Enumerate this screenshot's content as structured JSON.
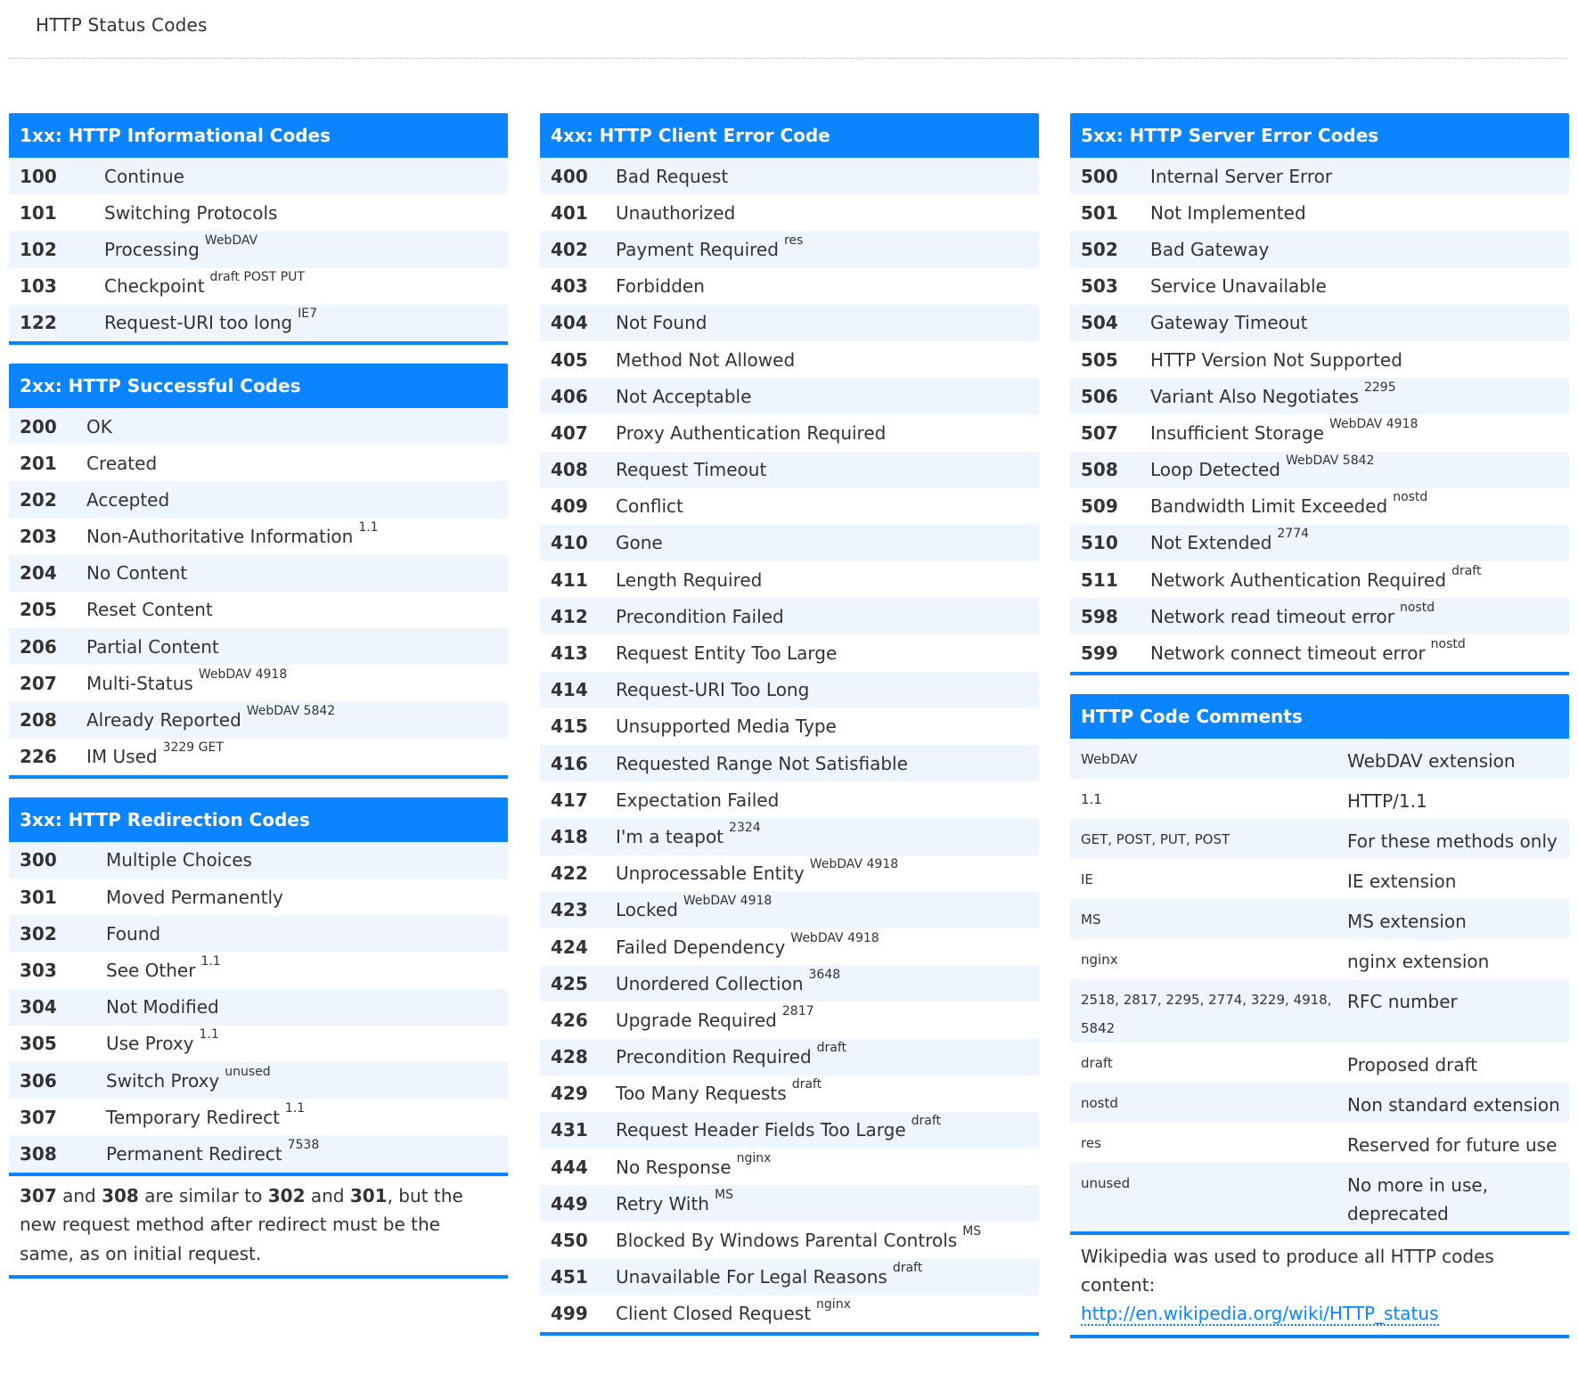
{
  "page_title": "HTTP Status Codes",
  "sections": {
    "s1xx": {
      "title": "1xx: HTTP Informational Codes",
      "rows": [
        {
          "code": "100",
          "label": "Continue",
          "note": ""
        },
        {
          "code": "101",
          "label": "Switching Protocols",
          "note": ""
        },
        {
          "code": "102",
          "label": "Processing",
          "note": "WebDAV"
        },
        {
          "code": "103",
          "label": "Checkpoint",
          "note": "draft POST PUT"
        },
        {
          "code": "122",
          "label": "Request-URI too long",
          "note": "IE7"
        }
      ]
    },
    "s2xx": {
      "title": "2xx: HTTP Successful Codes",
      "rows": [
        {
          "code": "200",
          "label": "OK",
          "note": ""
        },
        {
          "code": "201",
          "label": "Created",
          "note": ""
        },
        {
          "code": "202",
          "label": "Accepted",
          "note": ""
        },
        {
          "code": "203",
          "label": "Non-Authoritative Information",
          "note": "1.1"
        },
        {
          "code": "204",
          "label": "No Content",
          "note": ""
        },
        {
          "code": "205",
          "label": "Reset Content",
          "note": ""
        },
        {
          "code": "206",
          "label": "Partial Content",
          "note": ""
        },
        {
          "code": "207",
          "label": "Multi-Status",
          "note": "WebDAV 4918"
        },
        {
          "code": "208",
          "label": "Already Reported",
          "note": "WebDAV 5842"
        },
        {
          "code": "226",
          "label": "IM Used",
          "note": "3229 GET"
        }
      ]
    },
    "s3xx": {
      "title": "3xx: HTTP Redirection Codes",
      "rows": [
        {
          "code": "300",
          "label": "Multiple Choices",
          "note": ""
        },
        {
          "code": "301",
          "label": "Moved Permanently",
          "note": ""
        },
        {
          "code": "302",
          "label": "Found",
          "note": ""
        },
        {
          "code": "303",
          "label": "See Other",
          "note": "1.1"
        },
        {
          "code": "304",
          "label": "Not Modified",
          "note": ""
        },
        {
          "code": "305",
          "label": "Use Proxy",
          "note": "1.1"
        },
        {
          "code": "306",
          "label": "Switch Proxy",
          "note": "unused"
        },
        {
          "code": "307",
          "label": "Temporary Redirect",
          "note": "1.1"
        },
        {
          "code": "308",
          "label": "Permanent Redirect",
          "note": "7538"
        }
      ],
      "footnote": {
        "code_a": "307",
        "text_and": " and ",
        "code_b": "308",
        "text_mid": " are similar to ",
        "code_c": "302",
        "text_and2": " and ",
        "code_d": "301",
        "text_end": ", but the new request method after redirect must be the same, as on initial request."
      }
    },
    "s4xx": {
      "title": "4xx: HTTP Client Error Code",
      "rows": [
        {
          "code": "400",
          "label": "Bad Request",
          "note": ""
        },
        {
          "code": "401",
          "label": "Unauthorized",
          "note": ""
        },
        {
          "code": "402",
          "label": "Payment Required",
          "note": "res"
        },
        {
          "code": "403",
          "label": "Forbidden",
          "note": ""
        },
        {
          "code": "404",
          "label": "Not Found",
          "note": ""
        },
        {
          "code": "405",
          "label": "Method Not Allowed",
          "note": ""
        },
        {
          "code": "406",
          "label": "Not Acceptable",
          "note": ""
        },
        {
          "code": "407",
          "label": "Proxy Authentication Required",
          "note": ""
        },
        {
          "code": "408",
          "label": "Request Timeout",
          "note": ""
        },
        {
          "code": "409",
          "label": "Conflict",
          "note": ""
        },
        {
          "code": "410",
          "label": "Gone",
          "note": ""
        },
        {
          "code": "411",
          "label": "Length Required",
          "note": ""
        },
        {
          "code": "412",
          "label": "Precondition Failed",
          "note": ""
        },
        {
          "code": "413",
          "label": "Request Entity Too Large",
          "note": ""
        },
        {
          "code": "414",
          "label": "Request-URI Too Long",
          "note": ""
        },
        {
          "code": "415",
          "label": "Unsupported Media Type",
          "note": ""
        },
        {
          "code": "416",
          "label": "Requested Range Not Satisfiable",
          "note": ""
        },
        {
          "code": "417",
          "label": "Expectation Failed",
          "note": ""
        },
        {
          "code": "418",
          "label": "I'm a teapot",
          "note": "2324"
        },
        {
          "code": "422",
          "label": "Unprocessable Entity",
          "note": "WebDAV 4918"
        },
        {
          "code": "423",
          "label": "Locked",
          "note": "WebDAV 4918"
        },
        {
          "code": "424",
          "label": "Failed Dependency",
          "note": "WebDAV 4918"
        },
        {
          "code": "425",
          "label": "Unordered Collection",
          "note": "3648"
        },
        {
          "code": "426",
          "label": "Upgrade Required",
          "note": "2817"
        },
        {
          "code": "428",
          "label": "Precondition Required",
          "note": "draft"
        },
        {
          "code": "429",
          "label": "Too Many Requests",
          "note": "draft"
        },
        {
          "code": "431",
          "label": "Request Header Fields Too Large",
          "note": "draft"
        },
        {
          "code": "444",
          "label": "No Response",
          "note": "nginx"
        },
        {
          "code": "449",
          "label": "Retry With",
          "note": "MS"
        },
        {
          "code": "450",
          "label": "Blocked By Windows Parental Controls",
          "note": "MS"
        },
        {
          "code": "451",
          "label": "Unavailable For Legal Reasons",
          "note": "draft"
        },
        {
          "code": "499",
          "label": "Client Closed Request",
          "note": "nginx"
        }
      ]
    },
    "s5xx": {
      "title": "5xx: HTTP Server Error Codes",
      "rows": [
        {
          "code": "500",
          "label": "Internal Server Error",
          "note": ""
        },
        {
          "code": "501",
          "label": "Not Implemented",
          "note": ""
        },
        {
          "code": "502",
          "label": "Bad Gateway",
          "note": ""
        },
        {
          "code": "503",
          "label": "Service Unavailable",
          "note": ""
        },
        {
          "code": "504",
          "label": "Gateway Timeout",
          "note": ""
        },
        {
          "code": "505",
          "label": "HTTP Version Not Supported",
          "note": ""
        },
        {
          "code": "506",
          "label": "Variant Also Negotiates",
          "note": "2295"
        },
        {
          "code": "507",
          "label": "Insufficient Storage",
          "note": "WebDAV 4918"
        },
        {
          "code": "508",
          "label": "Loop Detected",
          "note": "WebDAV 5842"
        },
        {
          "code": "509",
          "label": "Bandwidth Limit Exceeded",
          "note": "nostd"
        },
        {
          "code": "510",
          "label": "Not Extended",
          "note": "2774"
        },
        {
          "code": "511",
          "label": "Network Authentication Required",
          "note": "draft"
        },
        {
          "code": "598",
          "label": "Network read timeout error",
          "note": "nostd"
        },
        {
          "code": "599",
          "label": "Network connect timeout error",
          "note": "nostd"
        }
      ]
    },
    "comments": {
      "title": "HTTP Code Comments",
      "rows": [
        {
          "key": "WebDAV",
          "value": "WebDAV extension"
        },
        {
          "key": "1.1",
          "value": "HTTP/1.1"
        },
        {
          "key": "GET, POST, PUT, POST",
          "value": "For these methods only"
        },
        {
          "key": "IE",
          "value": "IE extension"
        },
        {
          "key": "MS",
          "value": "MS extension"
        },
        {
          "key": "nginx",
          "value": "nginx extension"
        },
        {
          "key": "2518, 2817, 2295, 2774, 3229, 4918, 5842",
          "value": "RFC number"
        },
        {
          "key": "draft",
          "value": "Proposed draft"
        },
        {
          "key": "nostd",
          "value": "Non standard extension"
        },
        {
          "key": "res",
          "value": "Reserved for future use"
        },
        {
          "key": "unused",
          "value": "No more in use, deprecated"
        }
      ],
      "footer_text": "Wikipedia was used to produce all HTTP codes content:",
      "footer_link": "http://en.wikipedia.org/wiki/HTTP_status"
    }
  },
  "colors": {
    "accent": "#0a84ff",
    "row_alt": "#eef5fd",
    "text": "#333333"
  }
}
